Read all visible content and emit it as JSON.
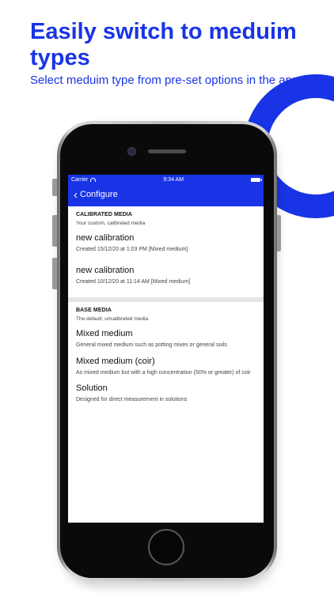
{
  "promo": {
    "headline": "Easily switch to meduim types",
    "subheadline": "Select meduim type from pre-set options in the app",
    "accent_color": "#1934e6"
  },
  "device": {
    "status_bar": {
      "carrier": "Carrier",
      "time": "9:34 AM"
    },
    "nav": {
      "back_label": "Configure",
      "back_icon": "chevron-left-icon"
    }
  },
  "calibrated": {
    "title": "CALIBRATED MEDIA",
    "subtitle": "Your custom, calibrated media",
    "items": [
      {
        "title": "new calibration",
        "desc": "Created 15/12/20 at 1:03 PM [Mixed medium]"
      },
      {
        "title": "new calibration",
        "desc": "Created 10/12/20 at 11:14 AM [Mixed medium]"
      }
    ]
  },
  "base": {
    "title": "BASE MEDIA",
    "subtitle": "The default, uncalibrated media",
    "items": [
      {
        "title": "Mixed medium",
        "desc": "General mixed medium such as potting mixes or general soils"
      },
      {
        "title": "Mixed medium (coir)",
        "desc": "As mixed medium but with a high concentration (50% or greater) of coir"
      },
      {
        "title": "Solution",
        "desc": "Designed for direct measurement in solutions"
      }
    ]
  }
}
